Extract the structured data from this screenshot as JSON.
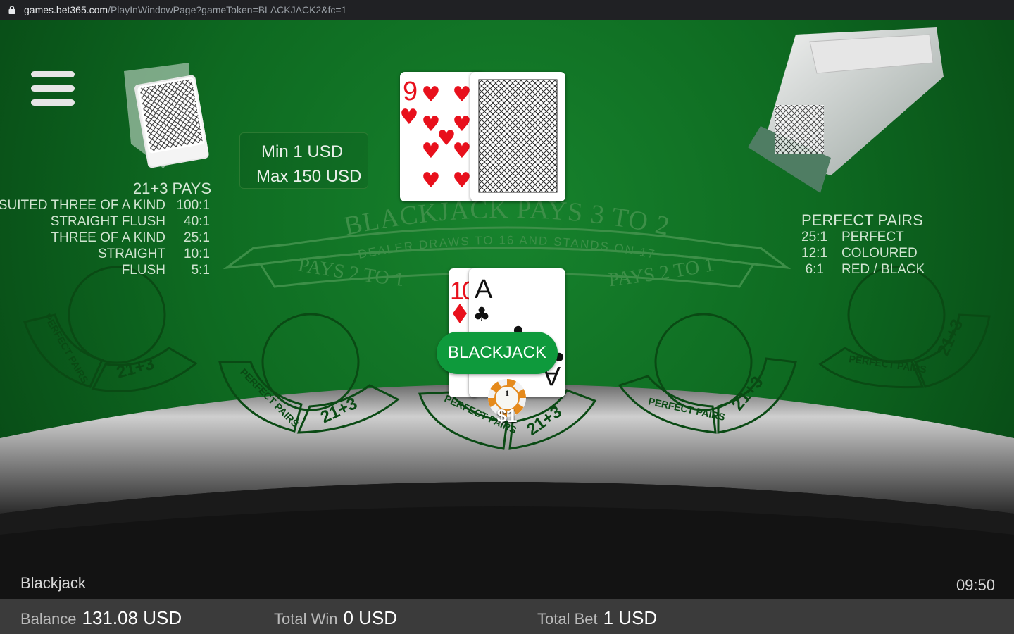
{
  "browser": {
    "domain": "games.bet365.com",
    "path": "/PlayInWindowPage?gameToken=BLACKJACK2&fc=1"
  },
  "table": {
    "limits": {
      "min": "Min 1 USD",
      "max": "Max 150 USD"
    },
    "main_arc_text": "BLACKJACK PAYS 3 TO 2",
    "dealer_rule": "DEALER DRAWS TO 16 AND STANDS ON 17",
    "insurance_left": "PAYS 2 TO 1",
    "insurance_right": "PAYS 2 TO 1",
    "spot_perfect_pairs": "PERFECT PAIRS",
    "spot_21_3": "21+3"
  },
  "paytable_21_3": {
    "title": "21+3 PAYS",
    "rows": [
      {
        "name": "SUITED THREE OF A KIND",
        "odds": "100:1"
      },
      {
        "name": "STRAIGHT FLUSH",
        "odds": "40:1"
      },
      {
        "name": "THREE OF A KIND",
        "odds": "25:1"
      },
      {
        "name": "STRAIGHT",
        "odds": "10:1"
      },
      {
        "name": "FLUSH",
        "odds": "5:1"
      }
    ]
  },
  "paytable_perfect_pairs": {
    "title": "PERFECT PAIRS",
    "rows": [
      {
        "odds": "25:1",
        "name": "PERFECT"
      },
      {
        "odds": "12:1",
        "name": "COLOURED"
      },
      {
        "odds": "6:1",
        "name": "RED / BLACK"
      }
    ]
  },
  "dealer_hand": {
    "up_card": {
      "rank": "9",
      "suit": "hearts"
    },
    "hole_card": "face-down"
  },
  "player_hand": {
    "cards": [
      {
        "rank": "10",
        "suit": "diamonds"
      },
      {
        "rank": "A",
        "suit": "clubs"
      }
    ],
    "result": "BLACKJACK",
    "chip_value": "1",
    "bet_label": "$1"
  },
  "game": {
    "title": "Blackjack",
    "clock": "09:50"
  },
  "status": {
    "balance_label": "Balance",
    "balance_value": "131.08 USD",
    "win_label": "Total Win",
    "win_value": "0 USD",
    "bet_label": "Total Bet",
    "bet_value": "1 USD"
  },
  "colors": {
    "felt": "#106e22",
    "badge": "#0e9a3c",
    "heart": "#e8101c",
    "club": "#111111"
  }
}
